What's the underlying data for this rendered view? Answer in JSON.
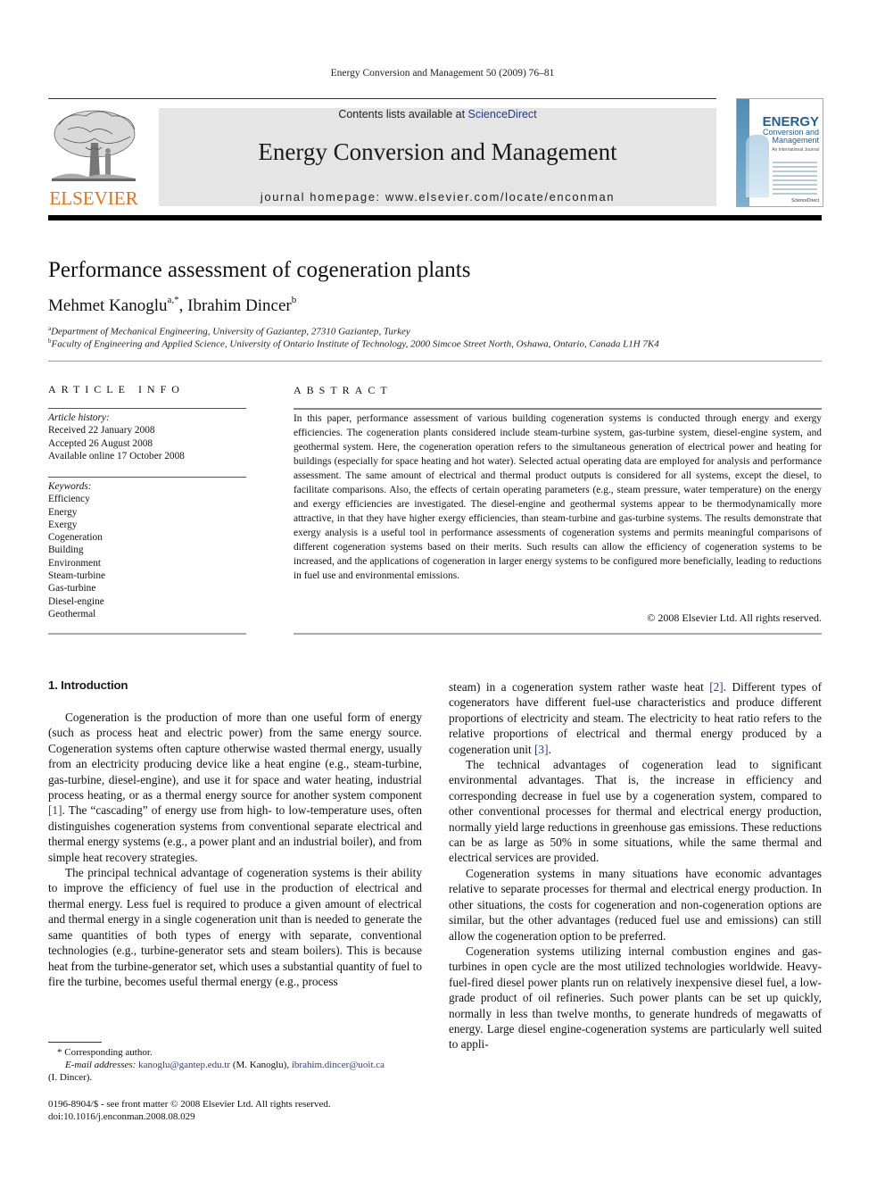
{
  "running_head": "Energy Conversion and Management 50 (2009) 76–81",
  "publisher": {
    "name": "ELSEVIER",
    "brand_color": "#e9711c"
  },
  "banner": {
    "contents_prefix": "Contents lists available at ",
    "contents_link": "ScienceDirect",
    "journal_title": "Energy Conversion and Management",
    "homepage": "journal homepage: www.elsevier.com/locate/enconman",
    "background": "#e5e5e5",
    "link_color": "#1f3a93"
  },
  "cover": {
    "title_line1": "ENERGY",
    "title_line2": "Conversion and",
    "title_line3": "Management",
    "subtitle": "An International Journal",
    "badge": "ScienceDirect"
  },
  "article": {
    "title": "Performance assessment of cogeneration plants",
    "authors": [
      {
        "name": "Mehmet Kanoglu",
        "sup": "a,*"
      },
      {
        "name": "Ibrahim Dincer",
        "sup": "b"
      }
    ],
    "author_separator": ", ",
    "affiliations": [
      {
        "mark": "a",
        "text": "Department of Mechanical Engineering, University of Gaziantep, 27310 Gaziantep, Turkey"
      },
      {
        "mark": "b",
        "text": "Faculty of Engineering and Applied Science, University of Ontario Institute of Technology, 2000 Simcoe Street North, Oshawa, Ontario, Canada L1H 7K4"
      }
    ]
  },
  "article_info": {
    "heading": "ARTICLE INFO",
    "history_label": "Article history:",
    "history": [
      "Received 22 January 2008",
      "Accepted 26 August 2008",
      "Available online 17 October 2008"
    ],
    "keywords_label": "Keywords:",
    "keywords": [
      "Efficiency",
      "Energy",
      "Exergy",
      "Cogeneration",
      "Building",
      "Environment",
      "Steam-turbine",
      "Gas-turbine",
      "Diesel-engine",
      "Geothermal"
    ]
  },
  "abstract": {
    "heading": "ABSTRACT",
    "text": "In this paper, performance assessment of various building cogeneration systems is conducted through energy and exergy efficiencies. The cogeneration plants considered include steam-turbine system, gas-turbine system, diesel-engine system, and geothermal system. Here, the cogeneration operation refers to the simultaneous generation of electrical power and heating for buildings (especially for space heating and hot water). Selected actual operating data are employed for analysis and performance assessment. The same amount of electrical and thermal product outputs is considered for all systems, except the diesel, to facilitate comparisons. Also, the effects of certain operating parameters (e.g., steam pressure, water temperature) on the energy and exergy efficiencies are investigated. The diesel-engine and geothermal systems appear to be thermodynamically more attractive, in that they have higher exergy efficiencies, than steam-turbine and gas-turbine systems. The results demonstrate that exergy analysis is a useful tool in performance assessments of cogeneration systems and permits meaningful comparisons of different cogeneration systems based on their merits. Such results can allow the efficiency of cogeneration systems to be increased, and the applications of cogeneration in larger energy systems to be configured more beneficially, leading to reductions in fuel use and environmental emissions.",
    "copyright": "© 2008 Elsevier Ltd. All rights reserved."
  },
  "body": {
    "section_heading": "1. Introduction",
    "left_paragraphs": [
      {
        "before": "Cogeneration is the production of more than one useful form of energy (such as process heat and electric power) from the same energy source. Cogeneration systems often capture otherwise wasted thermal energy, usually from an electricity producing device like a heat engine (e.g., steam-turbine, gas-turbine, diesel-engine), and use it for space and water heating, industrial process heating, or as a thermal energy source for another system component ",
        "ref": "[1]",
        "after": ". The “cascading” of energy use from high- to low-temperature uses, often distinguishes cogeneration systems from conventional separate electrical and thermal energy systems (e.g., a power plant and an industrial boiler), and from simple heat recovery strategies."
      },
      {
        "before": "The principal technical advantage of cogeneration systems is their ability to improve the efficiency of fuel use in the production of electrical and thermal energy. Less fuel is required to produce a given amount of electrical and thermal energy in a single cogeneration unit than is needed to generate the same quantities of both types of energy with separate, conventional technologies (e.g., turbine-generator sets and steam boilers). This is because heat from the turbine-generator set, which uses a substantial quantity of fuel to fire the turbine, becomes useful thermal energy (e.g., process",
        "ref": "",
        "after": ""
      }
    ],
    "right_paragraphs": [
      {
        "before": "steam) in a cogeneration system rather waste heat ",
        "ref": "[2]",
        "middle": ". Different types of cogenerators have different fuel-use characteristics and produce different proportions of electricity and steam. The electricity to heat ratio refers to the relative proportions of electrical and thermal energy produced by a cogeneration unit ",
        "ref2": "[3]",
        "after": "."
      },
      {
        "before": "The technical advantages of cogeneration lead to significant environmental advantages. That is, the increase in efficiency and corresponding decrease in fuel use by a cogeneration system, compared to other conventional processes for thermal and electrical energy production, normally yield large reductions in greenhouse gas emissions. These reductions can be as large as 50% in some situations, while the same thermal and electrical services are provided."
      },
      {
        "before": "Cogeneration systems in many situations have economic advantages relative to separate processes for thermal and electrical energy production. In other situations, the costs for cogeneration and non-cogeneration options are similar, but the other advantages (reduced fuel use and emissions) can still allow the cogeneration option to be preferred."
      },
      {
        "before": "Cogeneration systems utilizing internal combustion engines and gas-turbines in open cycle are the most utilized technologies worldwide. Heavy-fuel-fired diesel power plants run on relatively inexpensive diesel fuel, a low-grade product of oil refineries. Such power plants can be set up quickly, normally in less than twelve months, to generate hundreds of megawatts of energy. Large diesel engine-cogeneration systems are particularly well suited to appli-"
      }
    ]
  },
  "footnotes": {
    "corresponding": "* Corresponding author.",
    "email_label": "E-mail addresses:",
    "email1": "kanoglu@gantep.edu.tr",
    "email1_owner": " (M. Kanoglu), ",
    "email2": "ibrahim.dincer@uoit.ca",
    "email2_owner": "(I. Dincer).",
    "front_matter": "0196-8904/$ - see front matter © 2008 Elsevier Ltd. All rights reserved.",
    "doi": "doi:10.1016/j.enconman.2008.08.029"
  }
}
